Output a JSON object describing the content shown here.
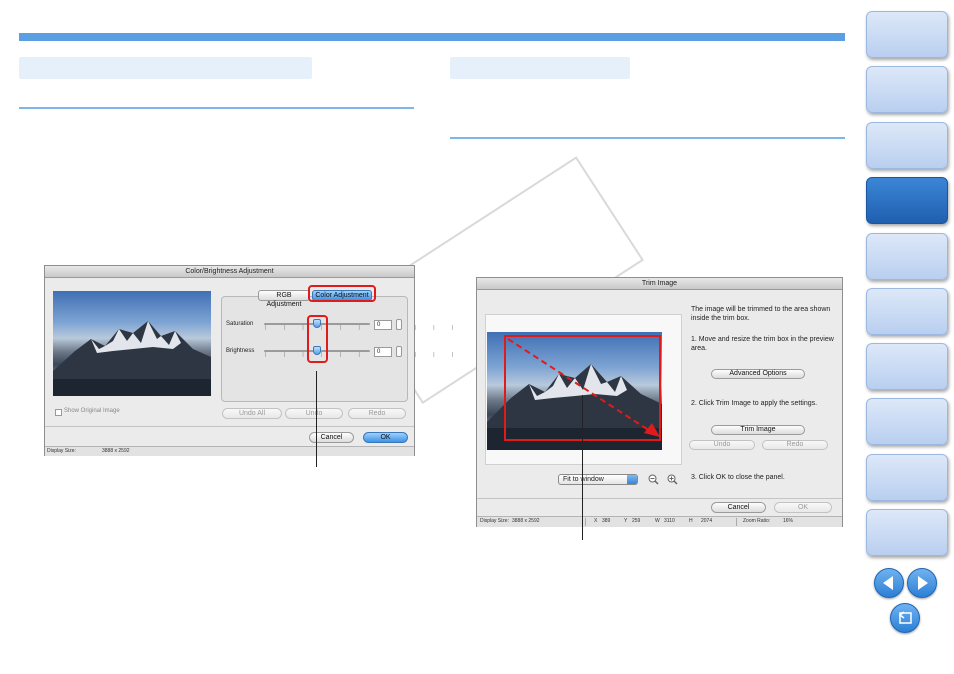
{
  "left_dialog": {
    "title": "Color/Brightness Adjustment",
    "tabs": [
      "RGB Adjustment",
      "Color Adjustment"
    ],
    "saturation_label": "Saturation",
    "saturation_value": "0",
    "brightness_label": "Brightness",
    "brightness_value": "0",
    "show_original_label": "Show Original Image",
    "undo_all_label": "Undo All",
    "undo_label": "Undo",
    "redo_label": "Redo",
    "cancel_label": "Cancel",
    "ok_label": "OK",
    "display_size_label": "Display Size:",
    "display_size_value": "3888 x 2592"
  },
  "right_dialog": {
    "title": "Trim Image",
    "instruction_intro": "The image will be trimmed to the area shown inside the trim box.",
    "step1": "1.  Move and resize the trim box in the preview area.",
    "advanced_options_label": "Advanced Options",
    "step2": "2. Click Trim Image to apply the settings.",
    "trim_image_label": "Trim Image",
    "undo_label": "Undo",
    "redo_label": "Redo",
    "step3": "3. Click OK to close the panel.",
    "fit_select_value": "Fit to window",
    "cancel_label": "Cancel",
    "ok_label": "OK",
    "status": {
      "display_size_label": "Display Size:",
      "display_size_value": "3888 x 2592",
      "x_label": "X",
      "x_value": "389",
      "y_label": "Y",
      "y_value": "259",
      "w_label": "W",
      "w_value": "3110",
      "h_label": "H",
      "h_value": "2074",
      "zoom_label": "Zoom Ratio:",
      "zoom_value": "16%"
    }
  },
  "colors": {
    "accent": "#5b9fe3",
    "highlight": "#e01b1b",
    "active_tab": "#2a6fc4"
  },
  "icons": [
    "zoom-out-icon",
    "zoom-in-icon",
    "prev-page-icon",
    "next-page-icon",
    "return-icon",
    "checkbox-icon",
    "stepper-icon"
  ]
}
